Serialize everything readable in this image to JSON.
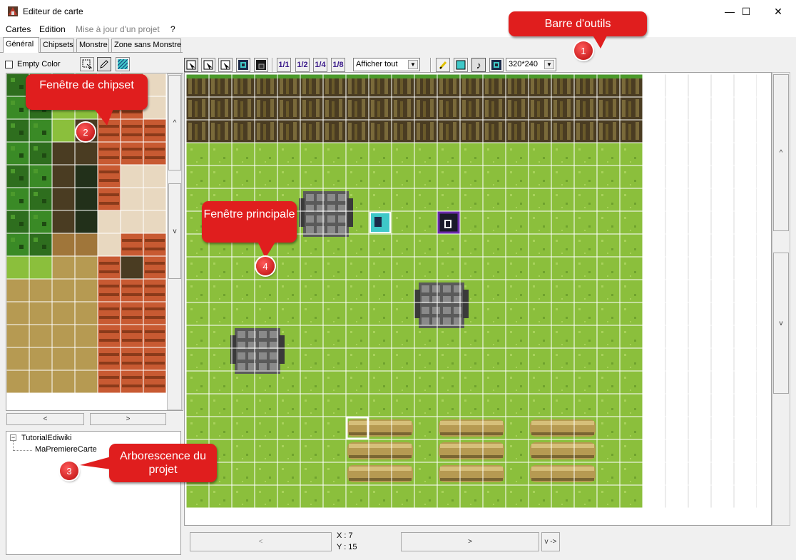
{
  "window": {
    "title": "Editeur de carte",
    "minimize": "—",
    "maximize": "☐",
    "close": "✕"
  },
  "menu": [
    "Cartes",
    "Edition",
    "Mise à jour d'un projet",
    "?"
  ],
  "tabs": [
    "Général",
    "Chipsets",
    "Monstre",
    "Zone sans Monstre"
  ],
  "left_toolbar": {
    "empty_color_label": "Empty Color",
    "empty_color_checked": false
  },
  "main_toolbar": {
    "layer_buttons": [
      "layer1-icon",
      "layer2-icon",
      "layer3-icon",
      "event-icon",
      "event-dark-icon"
    ],
    "zoom_buttons": [
      "1/1",
      "1/2",
      "1/4",
      "1/8"
    ],
    "display_select": "Afficher tout",
    "resolution_select": "320*240"
  },
  "chipset_nav": {
    "left": "<",
    "right": ">",
    "up": "^",
    "down": "v"
  },
  "tree": {
    "root": "TutorialEdiwiki",
    "child": "MaPremiereCarte",
    "expander": "−"
  },
  "status": {
    "x": "X : 7",
    "y": "Y : 15",
    "left_arrow": "<",
    "right_arrow": ">",
    "v_button": "v ->"
  },
  "main_scroll": {
    "up": "^",
    "down": "v"
  },
  "callouts": {
    "c1": {
      "text": "Barre d'outils",
      "number": "1"
    },
    "c2": {
      "text": "Fenêtre de chipset",
      "number": "2"
    },
    "c3": {
      "text": "Arborescence du projet",
      "number": "3"
    },
    "c4": {
      "text": "Fenêtre principale",
      "number": "4"
    }
  },
  "colors": {
    "accent": "#e01e1e",
    "grass": "#8bbf3c",
    "grid": "#ffffff"
  }
}
